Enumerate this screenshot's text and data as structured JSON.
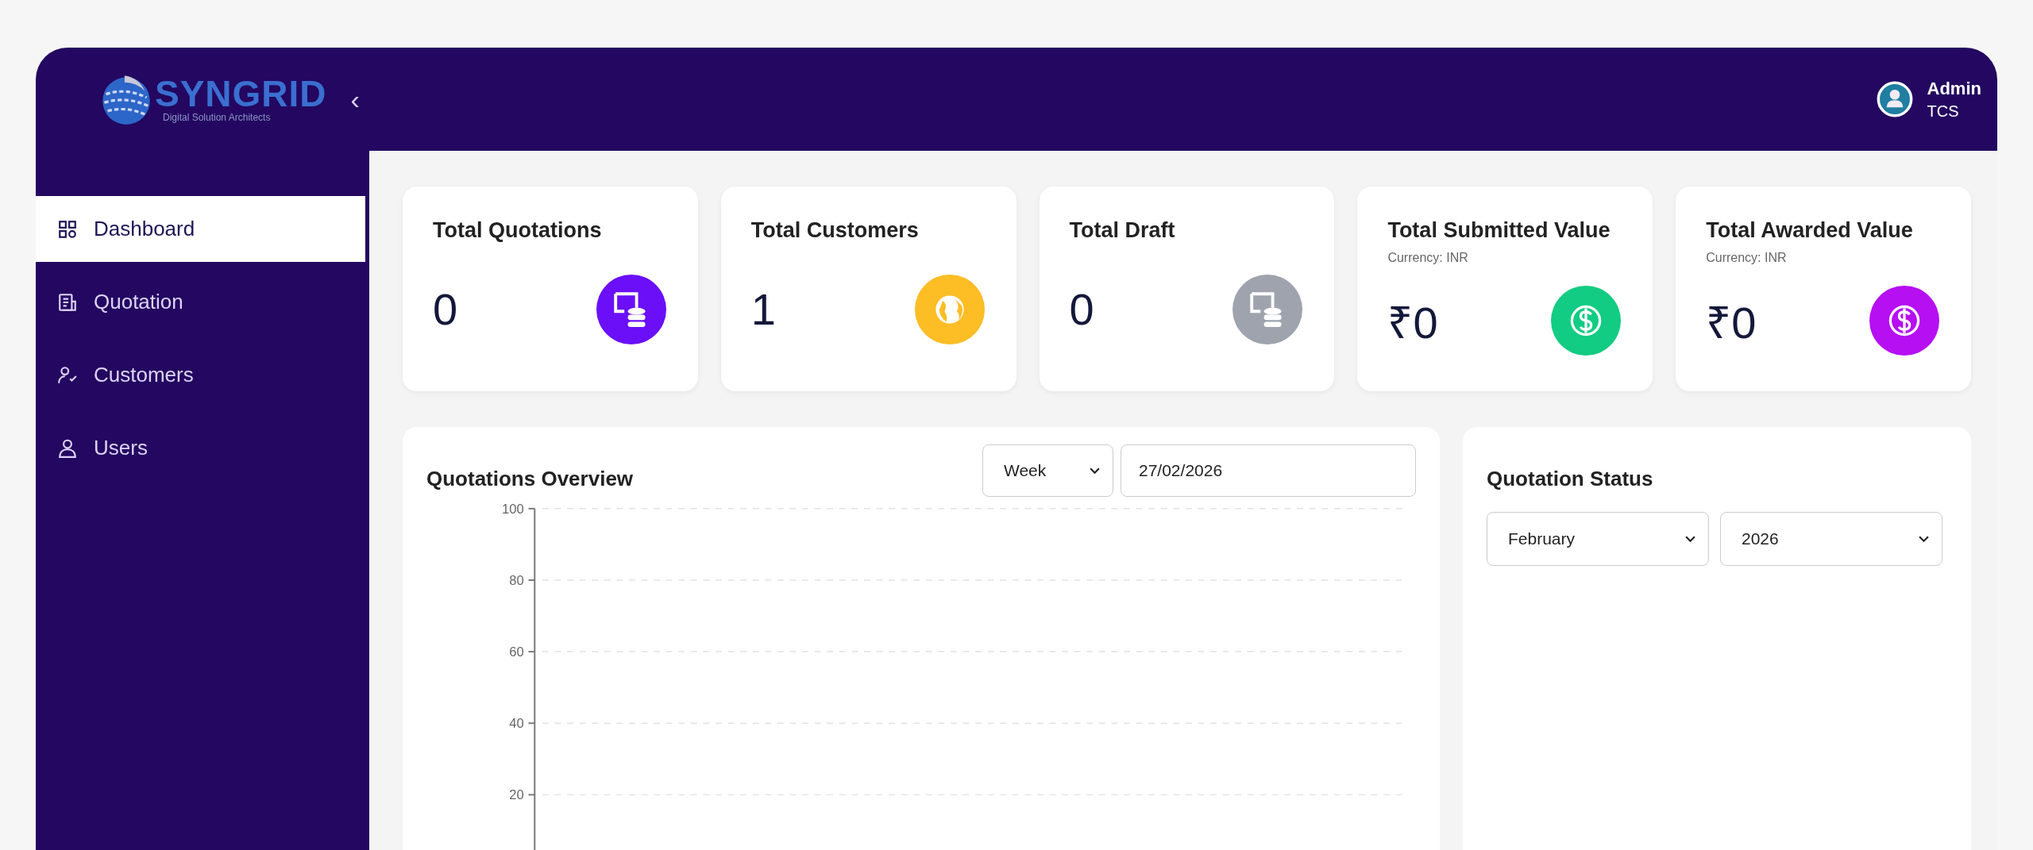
{
  "brand": {
    "name": "SYNGRID",
    "tagline": "Digital Solution Architects",
    "collapse": "‹"
  },
  "user": {
    "name": "Admin",
    "org": "TCS"
  },
  "sidebar": {
    "items": [
      {
        "label": "Dashboard",
        "kind": "grid",
        "selected": true
      },
      {
        "label": "Quotation",
        "kind": "doc",
        "selected": false
      },
      {
        "label": "Customers",
        "kind": "usercheck",
        "selected": false
      },
      {
        "label": "Users",
        "kind": "user",
        "selected": false
      }
    ]
  },
  "cards": [
    {
      "title": "Total Quotations",
      "value": "0",
      "kind": "stack",
      "color": "#6a0ff7"
    },
    {
      "title": "Total Customers",
      "value": "1",
      "kind": "globe",
      "color": "#fcbd25"
    },
    {
      "title": "Total Draft",
      "value": "0",
      "kind": "stack",
      "color": "#9ea3ad"
    },
    {
      "title": "Total Submitted Value",
      "note": "Currency: INR",
      "value": "₹0",
      "kind": "dollar",
      "color": "#11cc82"
    },
    {
      "title": "Total Awarded Value",
      "note": "Currency: INR",
      "value": "₹0",
      "kind": "dollar",
      "color": "#b60ff2"
    }
  ],
  "overview": {
    "title": "Quotations Overview",
    "period": "Week",
    "date": "27/02/2026",
    "chart_data": {
      "type": "line",
      "grid": true,
      "categories": [
        null,
        null,
        null,
        null,
        null,
        null,
        null
      ],
      "series": [
        {
          "values": [
            null,
            null,
            null,
            null,
            null,
            null,
            null
          ]
        }
      ],
      "ylim": [
        0,
        100
      ],
      "yticks": [
        20,
        40,
        60,
        80,
        100
      ]
    }
  },
  "status": {
    "title": "Quotation Status",
    "month": "February",
    "year": "2026"
  }
}
